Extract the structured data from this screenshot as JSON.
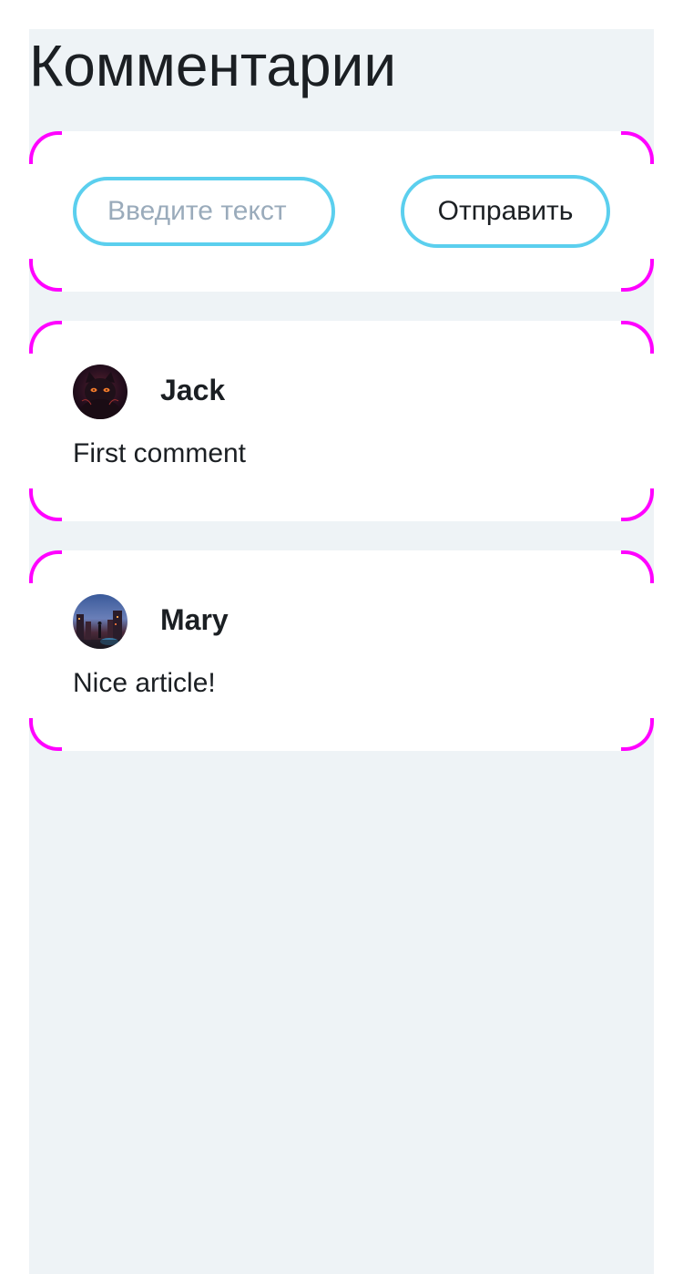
{
  "page": {
    "title": "Комментарии"
  },
  "form": {
    "input_placeholder": "Введите текст",
    "input_value": "",
    "submit_label": "Отправить"
  },
  "comments": [
    {
      "author": "Jack",
      "text": "First comment",
      "avatar_icon": "cat-avatar-icon"
    },
    {
      "author": "Mary",
      "text": "Nice article!",
      "avatar_icon": "city-avatar-icon"
    }
  ],
  "colors": {
    "background": "#eef3f6",
    "card": "#ffffff",
    "accent_border": "#5bcfee",
    "corner_accent": "#ff00ff",
    "placeholder": "#9aabbb",
    "text": "#1b1f23"
  }
}
